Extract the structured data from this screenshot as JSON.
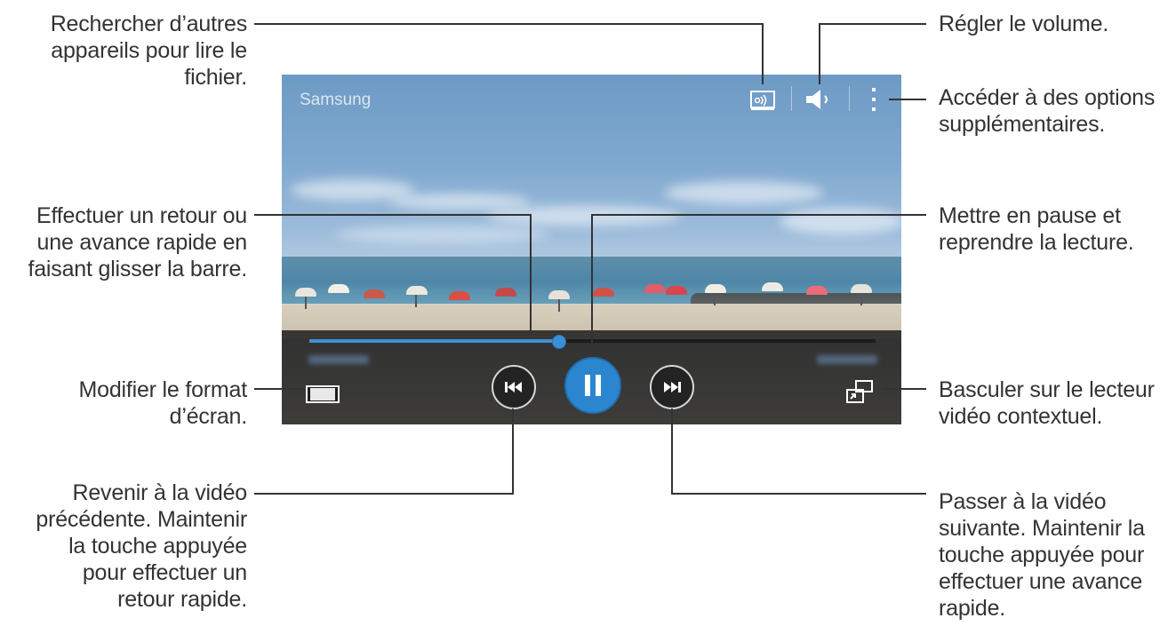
{
  "callouts": {
    "cast_devices": "Rechercher d’autres\nappareils pour lire le\nfichier.",
    "seek": "Effectuer un retour ou\nune avance rapide en\nfaisant glisser la barre.",
    "aspect_ratio": "Modifier le format\nd’écran.",
    "previous": "Revenir à la vidéo\nprécédente. Maintenir\nla touche appuyée\npour effectuer un\nretour rapide.",
    "volume": "Régler le volume.",
    "more_options": "Accéder à des options\nsupplémentaires.",
    "pause": "Mettre en pause et\nreprendre la lecture.",
    "popup_player": "Basculer sur le lecteur\nvidéo contextuel.",
    "next": "Passer à la vidéo\nsuivante. Maintenir la\ntouche appuyée pour\neffectuer une avance\nrapide."
  },
  "player": {
    "title": "Samsung",
    "progress_fraction": 0.44,
    "icons": {
      "cast": "screen-mirroring-icon",
      "volume": "speaker-icon",
      "more": "more-options-icon",
      "aspect": "aspect-ratio-icon",
      "previous": "previous-track-icon",
      "pause": "pause-icon",
      "next": "next-track-icon",
      "popup": "popup-player-icon"
    },
    "accent_color": "#2b86cf"
  }
}
